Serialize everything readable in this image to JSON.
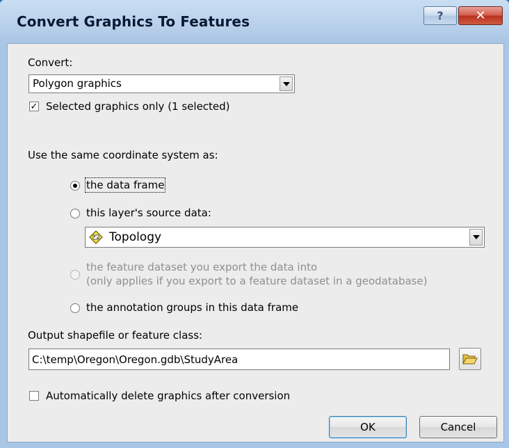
{
  "window": {
    "title": "Convert Graphics To Features",
    "help_glyph": "?",
    "close_glyph": "✕"
  },
  "convert": {
    "label": "Convert:",
    "selected": "Polygon graphics"
  },
  "selected_only": {
    "label": "Selected graphics only  (1 selected)",
    "checked": true,
    "check_glyph": "✓"
  },
  "coordinate": {
    "heading": "Use the same coordinate system as:",
    "options": [
      {
        "label": "the data frame",
        "selected": true,
        "enabled": true
      },
      {
        "label": "this layer's source data:",
        "selected": false,
        "enabled": true
      },
      {
        "label_line1": "the feature dataset you export the data into",
        "label_line2": "(only applies if you export to a feature dataset in a geodatabase)",
        "selected": false,
        "enabled": false
      },
      {
        "label": "the annotation groups in this data frame",
        "selected": false,
        "enabled": true
      }
    ],
    "layer_select": {
      "selected": "Topology",
      "icon": "topology-layer-icon"
    }
  },
  "output": {
    "label": "Output shapefile or feature class:",
    "value": "C:\\temp\\Oregon\\Oregon.gdb\\StudyArea",
    "browse_icon": "open-folder-icon"
  },
  "auto_delete": {
    "label": "Automatically delete graphics after conversion",
    "checked": false
  },
  "buttons": {
    "ok": "OK",
    "cancel": "Cancel"
  }
}
